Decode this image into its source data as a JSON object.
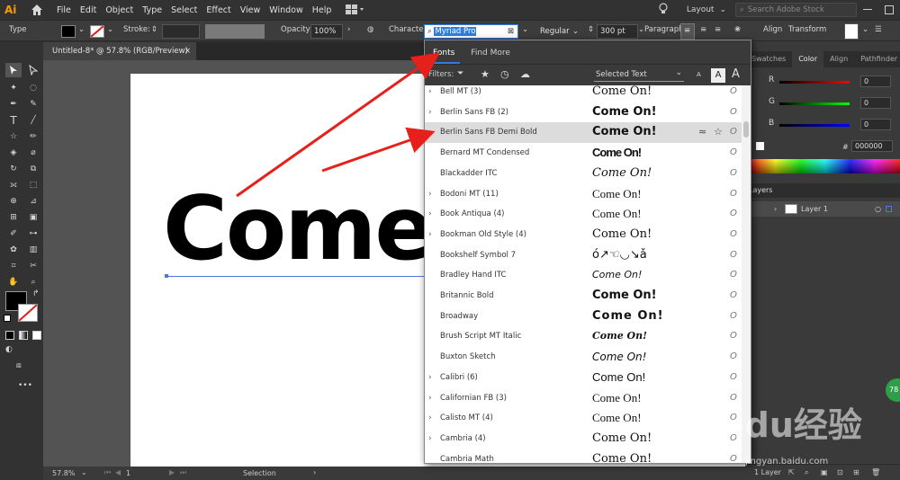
{
  "app": {
    "logo": "Ai"
  },
  "menu": [
    "File",
    "Edit",
    "Object",
    "Type",
    "Select",
    "Effect",
    "View",
    "Window",
    "Help"
  ],
  "menubar_right": {
    "workspace": "Layout",
    "search_placeholder": "Search Adobe Stock"
  },
  "controlbar": {
    "mode_label": "Type",
    "stroke_label": "Stroke:",
    "opacity_label": "Opacity:",
    "opacity_value": "100%",
    "character_label": "Character:",
    "font_value": "Myriad Pro",
    "style_value": "Regular",
    "size_value": "300 pt",
    "paragraph_label": "Paragraph:",
    "align_label": "Align",
    "transform_label": "Transform"
  },
  "document": {
    "tab_title": "Untitled-8* @ 57.8% (RGB/Preview)",
    "headline": "Come"
  },
  "font_panel": {
    "tabs": [
      "Fonts",
      "Find More"
    ],
    "filters_label": "Filters:",
    "selected_text_label": "Selected Text",
    "size_a_small": "A",
    "size_a_mid": "A",
    "size_a_large": "A",
    "type_glyph": "O",
    "fonts": [
      {
        "name": "Bell MT (3)",
        "sample": "Come On!",
        "has_children": true
      },
      {
        "name": "Berlin Sans FB (2)",
        "sample": "Come On!",
        "has_children": true
      },
      {
        "name": "Berlin Sans FB Demi Bold",
        "sample": "Come On!",
        "has_children": false,
        "highlighted": true
      },
      {
        "name": "Bernard MT Condensed",
        "sample": "Come On!",
        "has_children": false
      },
      {
        "name": "Blackadder ITC",
        "sample": "Come On!",
        "has_children": false
      },
      {
        "name": "Bodoni MT (11)",
        "sample": "Come On!",
        "has_children": true
      },
      {
        "name": "Book Antiqua (4)",
        "sample": "Come On!",
        "has_children": true
      },
      {
        "name": "Bookman Old Style (4)",
        "sample": "Come On!",
        "has_children": true
      },
      {
        "name": "Bookshelf Symbol 7",
        "sample": "ό↗☜◡↘ǎ",
        "has_children": false
      },
      {
        "name": "Bradley Hand ITC",
        "sample": "Come On!",
        "has_children": false
      },
      {
        "name": "Britannic Bold",
        "sample": "Come On!",
        "has_children": false
      },
      {
        "name": "Broadway",
        "sample": "Come On!",
        "has_children": false
      },
      {
        "name": "Brush Script MT Italic",
        "sample": "Come On!",
        "has_children": false
      },
      {
        "name": "Buxton Sketch",
        "sample": "Come On!",
        "has_children": false
      },
      {
        "name": "Calibri (6)",
        "sample": "Come On!",
        "has_children": true
      },
      {
        "name": "Californian FB (3)",
        "sample": "Come On!",
        "has_children": true
      },
      {
        "name": "Calisto MT (4)",
        "sample": "Come On!",
        "has_children": true
      },
      {
        "name": "Cambria (4)",
        "sample": "Come On!",
        "has_children": true
      },
      {
        "name": "Cambria Math",
        "sample": "Come On!",
        "has_children": false
      }
    ]
  },
  "right_panel": {
    "tabs": [
      "Swatches",
      "Color",
      "Align",
      "Pathfinder"
    ],
    "sliders": [
      {
        "label": "R",
        "value": "0"
      },
      {
        "label": "G",
        "value": "0"
      },
      {
        "label": "B",
        "value": "0"
      }
    ],
    "hex_prefix": "#",
    "hex_value": "000000",
    "layers_tab": "Layers",
    "layer_name": "Layer 1",
    "layers_count": "1 Layer"
  },
  "statusbar": {
    "zoom": "57.8%",
    "artboard": "1",
    "tool": "Selection"
  },
  "watermark": {
    "text": "Baidu经验",
    "url": "jingyan.baidu.com",
    "badge": "78"
  },
  "colors": {
    "arrow": "#e8201c",
    "highlight_row": "#dcdcdc",
    "accent": "#2d7fde"
  }
}
